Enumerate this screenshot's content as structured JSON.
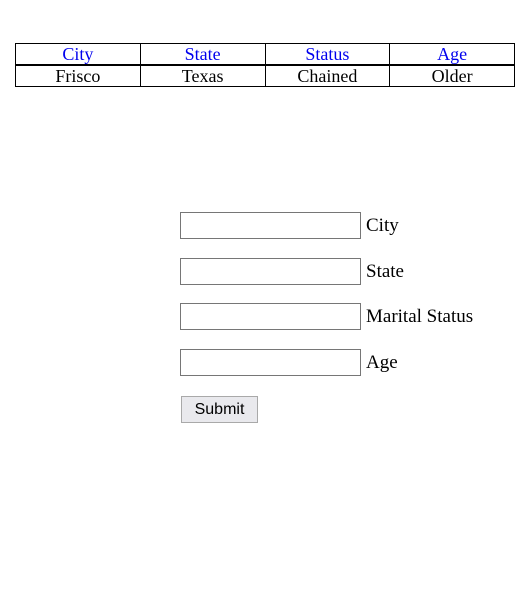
{
  "table": {
    "headers": [
      "City",
      "State",
      "Status",
      "Age"
    ],
    "row": [
      "Frisco",
      "Texas",
      "Chained",
      "Older"
    ]
  },
  "form": {
    "fields": [
      {
        "label": "City",
        "value": ""
      },
      {
        "label": "State",
        "value": ""
      },
      {
        "label": "Marital Status",
        "value": ""
      },
      {
        "label": "Age",
        "value": ""
      }
    ],
    "submit_label": "Submit"
  }
}
